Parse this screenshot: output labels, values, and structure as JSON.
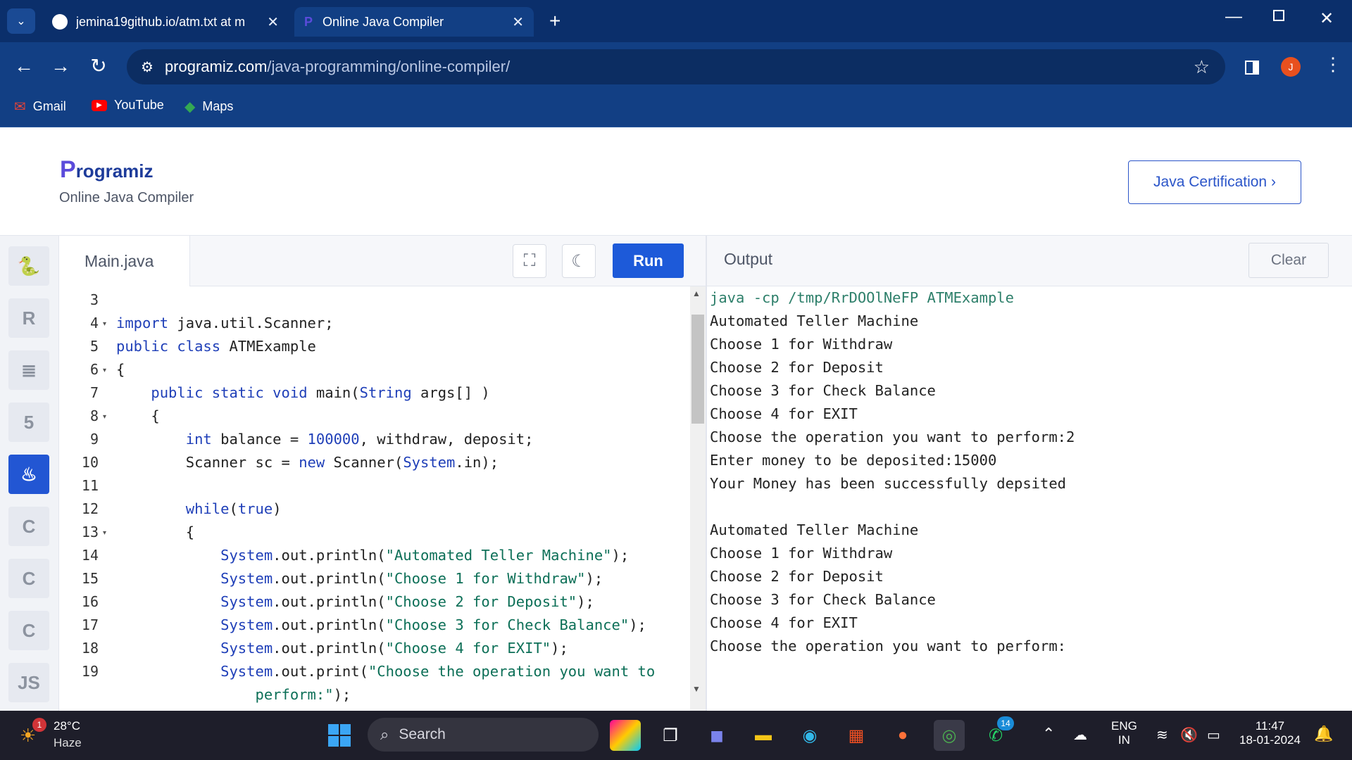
{
  "browser": {
    "tabs": [
      {
        "label": "jemina19github.io/atm.txt at m",
        "active": false
      },
      {
        "label": "Online Java Compiler",
        "active": true
      }
    ],
    "url_domain": "programiz.com",
    "url_path": "/java-programming/online-compiler/",
    "avatar_letter": "J",
    "bookmarks": [
      "Gmail",
      "YouTube",
      "Maps"
    ]
  },
  "header": {
    "logo_first": "P",
    "logo_rest": "rogramiz",
    "subtitle": "Online Java Compiler",
    "cert_button": "Java Certification ›"
  },
  "sidebar": {
    "items": [
      {
        "name": "python",
        "glyph": "🐍",
        "active": false
      },
      {
        "name": "r",
        "glyph": "R",
        "active": false
      },
      {
        "name": "sql",
        "glyph": "≣",
        "active": false
      },
      {
        "name": "html",
        "glyph": "5",
        "active": false
      },
      {
        "name": "java",
        "glyph": "♨",
        "active": true
      },
      {
        "name": "c",
        "glyph": "C",
        "active": false
      },
      {
        "name": "cpp",
        "glyph": "C",
        "active": false
      },
      {
        "name": "csharp",
        "glyph": "C",
        "active": false
      },
      {
        "name": "js",
        "glyph": "JS",
        "active": false
      }
    ]
  },
  "editor": {
    "filename": "Main.java",
    "run_label": "Run",
    "lines": [
      {
        "n": "3",
        "fold": false,
        "html": ""
      },
      {
        "n": "4",
        "fold": true,
        "html": "<span class='kw'>import</span> java.util.Scanner;"
      },
      {
        "n": "5",
        "fold": false,
        "html": "<span class='kw'>public class</span> ATMExample"
      },
      {
        "n": "6",
        "fold": true,
        "html": "{"
      },
      {
        "n": "7",
        "fold": false,
        "html": "    <span class='kw'>public static void</span> main(<span class='kw'>String</span> args[] )"
      },
      {
        "n": "8",
        "fold": true,
        "html": "    {"
      },
      {
        "n": "9",
        "fold": false,
        "html": "        <span class='kw'>int</span> balance = <span class='num'>100000</span>, withdraw, deposit;"
      },
      {
        "n": "10",
        "fold": false,
        "html": "        Scanner sc = <span class='kw'>new</span> Scanner(<span class='kw'>System</span>.in);"
      },
      {
        "n": "11",
        "fold": false,
        "html": ""
      },
      {
        "n": "12",
        "fold": false,
        "html": "        <span class='kw'>while</span>(<span class='kw'>true</span>)"
      },
      {
        "n": "13",
        "fold": true,
        "html": "        {"
      },
      {
        "n": "14",
        "fold": false,
        "html": "            <span class='kw'>System</span>.out.println(<span class='str'>\"Automated Teller Machine\"</span>);"
      },
      {
        "n": "15",
        "fold": false,
        "html": "            <span class='kw'>System</span>.out.println(<span class='str'>\"Choose 1 for Withdraw\"</span>);"
      },
      {
        "n": "16",
        "fold": false,
        "html": "            <span class='kw'>System</span>.out.println(<span class='str'>\"Choose 2 for Deposit\"</span>);"
      },
      {
        "n": "17",
        "fold": false,
        "html": "            <span class='kw'>System</span>.out.println(<span class='str'>\"Choose 3 for Check Balance\"</span>);"
      },
      {
        "n": "18",
        "fold": false,
        "html": "            <span class='kw'>System</span>.out.println(<span class='str'>\"Choose 4 for EXIT\"</span>);"
      },
      {
        "n": "19",
        "fold": false,
        "html": "            <span class='kw'>System</span>.out.print(<span class='str'>\"Choose the operation you want to</span>"
      },
      {
        "n": "",
        "fold": false,
        "html": "<span class='str'>                perform:\"</span>);"
      }
    ]
  },
  "output": {
    "title": "Output",
    "clear_label": "Clear",
    "lines": [
      {
        "text": "java -cp /tmp/RrDOOlNeFP ATMExample",
        "cmd": true
      },
      {
        "text": "Automated Teller Machine",
        "cmd": false
      },
      {
        "text": "Choose 1 for Withdraw",
        "cmd": false
      },
      {
        "text": "Choose 2 for Deposit",
        "cmd": false
      },
      {
        "text": "Choose 3 for Check Balance",
        "cmd": false
      },
      {
        "text": "Choose 4 for EXIT",
        "cmd": false
      },
      {
        "text": "Choose the operation you want to perform:2",
        "cmd": false
      },
      {
        "text": "Enter money to be deposited:15000",
        "cmd": false
      },
      {
        "text": "Your Money has been successfully depsited",
        "cmd": false
      },
      {
        "text": "",
        "cmd": false
      },
      {
        "text": "Automated Teller Machine",
        "cmd": false
      },
      {
        "text": "Choose 1 for Withdraw",
        "cmd": false
      },
      {
        "text": "Choose 2 for Deposit",
        "cmd": false
      },
      {
        "text": "Choose 3 for Check Balance",
        "cmd": false
      },
      {
        "text": "Choose 4 for EXIT",
        "cmd": false
      },
      {
        "text": "Choose the operation you want to perform:",
        "cmd": false
      }
    ]
  },
  "taskbar": {
    "weather_temp": "28°C",
    "weather_desc": "Haze",
    "weather_badge": "1",
    "search_label": "Search",
    "whatsapp_badge": "14",
    "lang_top": "ENG",
    "lang_bottom": "IN",
    "time": "11:47",
    "date": "18-01-2024"
  },
  "colors": {
    "accent": "#1d5ad9",
    "chrome_dark": "#0b2f6b",
    "chrome": "#123f84"
  }
}
